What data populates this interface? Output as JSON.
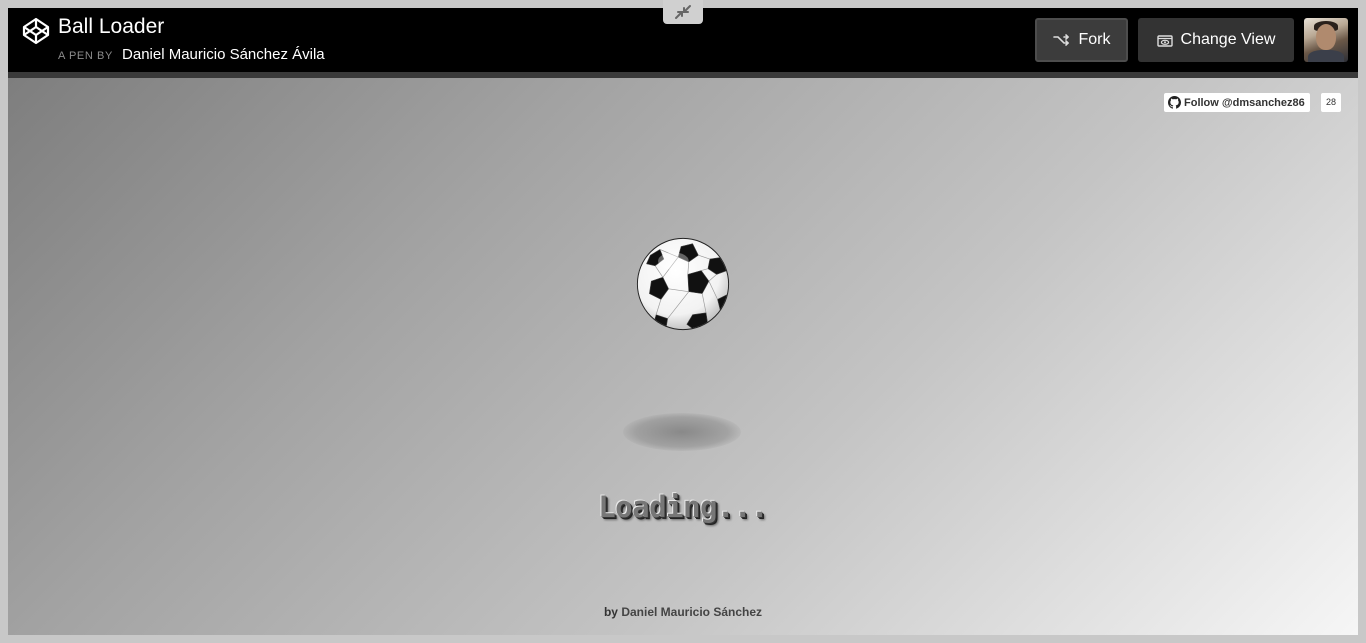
{
  "pen": {
    "title": "Ball Loader",
    "byline_prefix": "A PEN BY",
    "author": "Daniel Mauricio Sánchez Ávila"
  },
  "toolbar": {
    "fork_label": "Fork",
    "change_view_label": "Change View"
  },
  "icons": {
    "logo": "codepen-logo-icon",
    "fork": "fork-icon",
    "change_view": "eye-window-icon",
    "collapse": "collapse-arrows-icon",
    "github": "github-icon"
  },
  "preview": {
    "github_follow_label": "Follow @dmsanchez86",
    "github_follower_count": "28",
    "loading_text": "Loading...",
    "credit_prefix": "by",
    "credit_name": "Daniel Mauricio Sánchez"
  },
  "colors": {
    "header_bg": "#000000",
    "button_bg": "#333333",
    "stage_gradient_start": "#7e7e7e",
    "stage_gradient_end": "#f6f6f6"
  }
}
